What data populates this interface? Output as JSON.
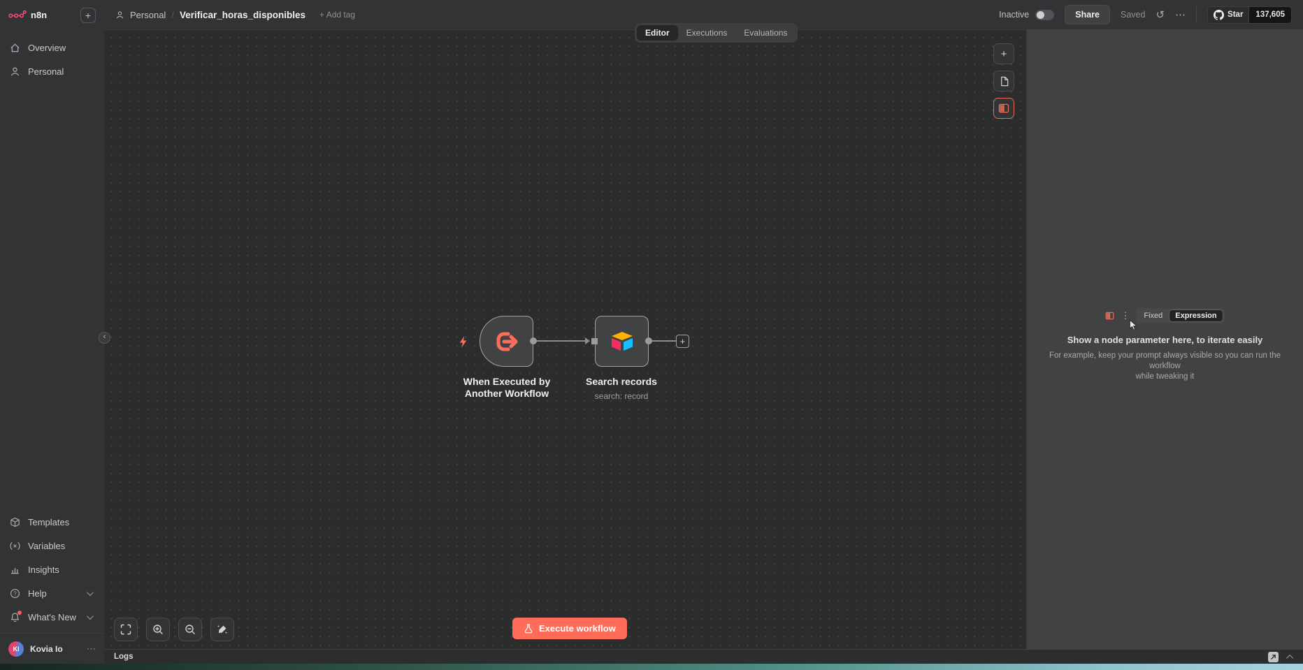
{
  "brand": {
    "name": "n8n"
  },
  "glyphs": {
    "plus": "+",
    "dots_h": "⋯",
    "dots_v": "⋮",
    "history": "↺",
    "collapse": "‹",
    "popout_arrow": "↗"
  },
  "sidebar": {
    "top_items": [
      {
        "label": "Overview"
      },
      {
        "label": "Personal"
      }
    ],
    "bottom_items": [
      {
        "label": "Templates"
      },
      {
        "label": "Variables"
      },
      {
        "label": "Insights"
      },
      {
        "label": "Help"
      },
      {
        "label": "What's New"
      }
    ],
    "user": {
      "initials": "KI",
      "name": "Kovia Io"
    }
  },
  "header": {
    "project": "Personal",
    "separator": "/",
    "workflow_name": "Verificar_horas_disponibles",
    "add_tag": "+ Add tag",
    "status": "Inactive",
    "share": "Share",
    "saved": "Saved",
    "github_star": "Star",
    "github_count": "137,605"
  },
  "tabs": {
    "editor": "Editor",
    "executions": "Executions",
    "evaluations": "Evaluations"
  },
  "canvas": {
    "trigger_node": {
      "label_line1": "When Executed by",
      "label_line2": "Another Workflow"
    },
    "search_node": {
      "label": "Search records",
      "subtitle": "search: record"
    },
    "execute_label": "Execute workflow"
  },
  "right_panel": {
    "fixed": "Fixed",
    "expression": "Expression",
    "title": "Show a node parameter here, to iterate easily",
    "subtitle_line1": "For example, keep your prompt always visible so you can run the workflow",
    "subtitle_line2": "while tweaking it"
  },
  "logs": {
    "title": "Logs"
  },
  "colors": {
    "accent": "#ff6d5a",
    "brand": "#ea4b71",
    "airtable_yellow": "#fcb400",
    "airtable_pink": "#f82b60",
    "airtable_blue": "#18bfff"
  }
}
